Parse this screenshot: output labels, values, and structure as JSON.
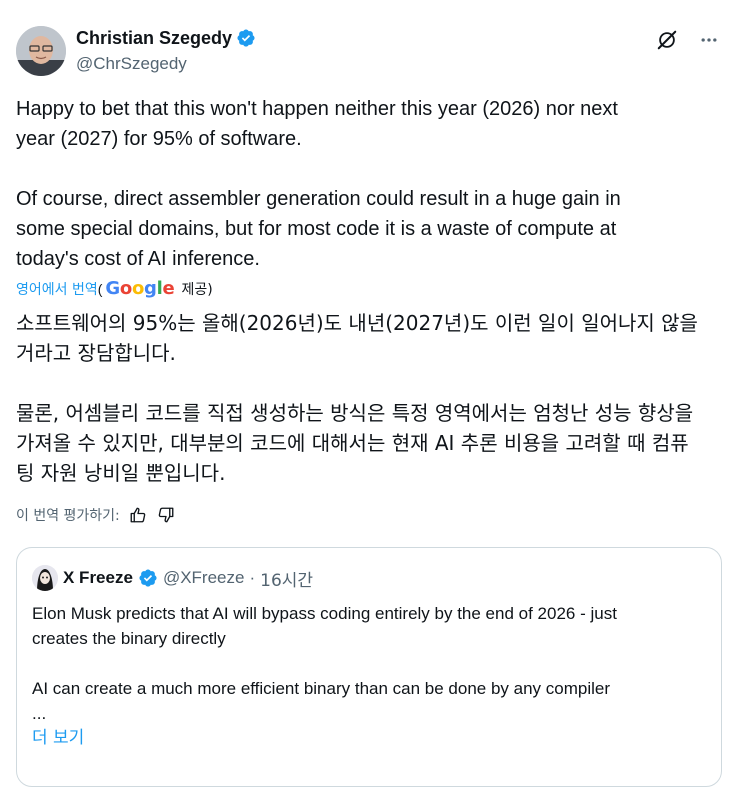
{
  "author": {
    "name": "Christian Szegedy",
    "handle": "@ChrSzegedy",
    "verified_color": "#1d9bf0"
  },
  "actions": {
    "grok_icon": "grok-icon",
    "more_icon": "more-icon"
  },
  "tweet": {
    "text": "Happy to bet that this won't happen neither this year (2026) nor next\nyear (2027) for 95% of software.\n\nOf course, direct assembler generation could result in a huge gain in\nsome special domains, but for most code it is a waste of compute at\ntoday's cost of AI inference."
  },
  "translation": {
    "label": "영어에서 번역",
    "paren_open": "(",
    "google": "Google",
    "provided": "제공)",
    "text": "소프트웨어의 95%는 올해(2026년)도 내년(2027년)도 이런 일이 일어나지 않을\n거라고 장담합니다.\n\n물론, 어셈블리 코드를 직접 생성하는 방식은 특정 영역에서는 엄청난 성능 향상을\n가져올 수 있지만, 대부분의 코드에 대해서는 현재 AI 추론 비용을 고려할 때 컴퓨\n팅 자원 낭비일 뿐입니다.",
    "rate_label": "이 번역 평가하기:"
  },
  "quote": {
    "name": "X Freeze",
    "handle": "@XFreeze",
    "separator": "·",
    "time": "16시간",
    "text": "Elon Musk predicts that AI will bypass coding entirely by the end of 2026 - just\ncreates the binary directly\n\nAI can create a much more efficient binary than can be done by any compiler\n...",
    "show_more": "더 보기"
  }
}
